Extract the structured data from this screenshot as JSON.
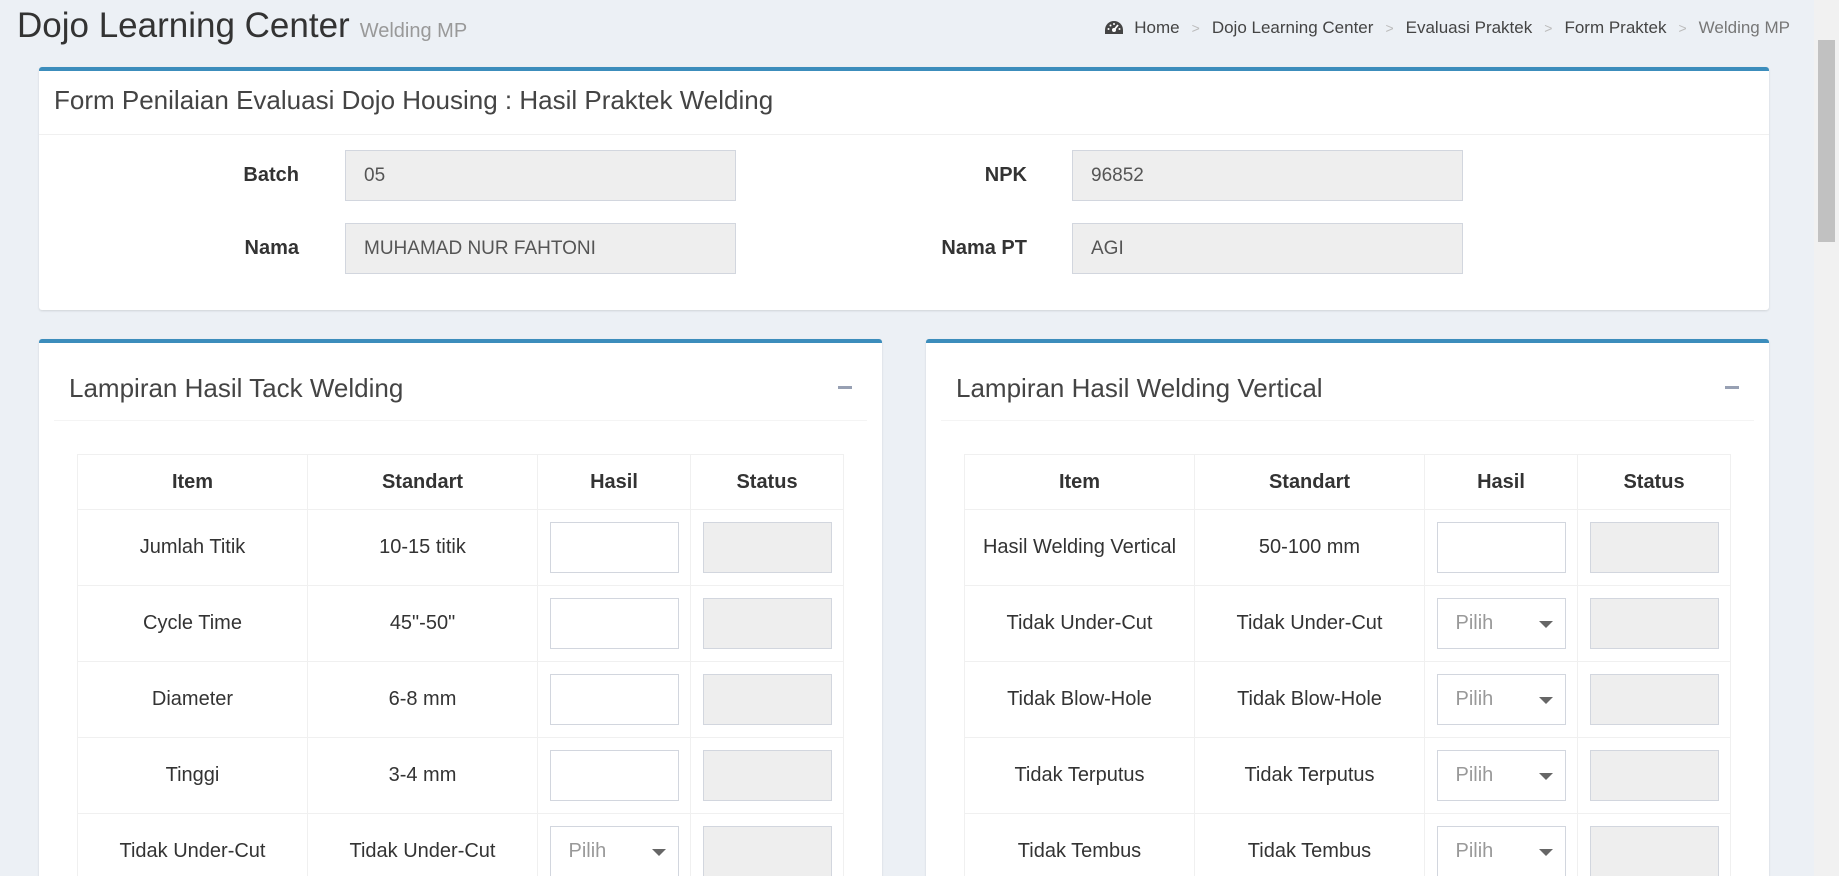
{
  "header": {
    "title": "Dojo Learning Center",
    "subtitle": "Welding MP"
  },
  "breadcrumb": {
    "icon": "dashboard-icon",
    "items": [
      "Home",
      "Dojo Learning Center",
      "Evaluasi Praktek",
      "Form Praktek",
      "Welding MP"
    ]
  },
  "form": {
    "title": "Form Penilaian Evaluasi Dojo Housing : Hasil Praktek Welding",
    "batch_label": "Batch",
    "batch_value": "05",
    "npk_label": "NPK",
    "npk_value": "96852",
    "nama_label": "Nama",
    "nama_value": "MUHAMAD NUR FAHTONI",
    "namapt_label": "Nama PT",
    "namapt_value": "AGI"
  },
  "tack": {
    "title": "Lampiran Hasil Tack Welding",
    "headers": [
      "Item",
      "Standart",
      "Hasil",
      "Status"
    ],
    "rows": [
      {
        "item": "Jumlah Titik",
        "standart": "10-15 titik"
      },
      {
        "item": "Cycle Time",
        "standart": "45\"-50\""
      },
      {
        "item": "Diameter",
        "standart": "6-8 mm"
      },
      {
        "item": "Tinggi",
        "standart": "3-4 mm"
      },
      {
        "item": "Tidak Under-Cut",
        "standart": "Tidak Under-Cut",
        "select": "Pilih"
      }
    ]
  },
  "vertical": {
    "title": "Lampiran Hasil Welding Vertical",
    "headers": [
      "Item",
      "Standart",
      "Hasil",
      "Status"
    ],
    "rows": [
      {
        "item": "Hasil Welding Vertical",
        "standart": "50-100 mm"
      },
      {
        "item": "Tidak Under-Cut",
        "standart": "Tidak Under-Cut",
        "select": "Pilih"
      },
      {
        "item": "Tidak Blow-Hole",
        "standart": "Tidak Blow-Hole",
        "select": "Pilih"
      },
      {
        "item": "Tidak Terputus",
        "standart": "Tidak Terputus",
        "select": "Pilih"
      },
      {
        "item": "Tidak Tembus",
        "standart": "Tidak Tembus",
        "select": "Pilih"
      }
    ]
  }
}
